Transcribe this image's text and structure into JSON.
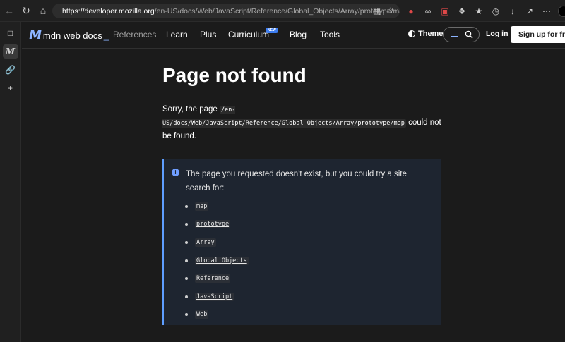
{
  "browser": {
    "url_host": "https://developer.mozilla.org",
    "url_path": "/en-US/docs/Web/JavaScript/Reference/Global_Objects/Array/prototype/map"
  },
  "header": {
    "logo_text": "mdn web docs",
    "logo_suffix": "_",
    "nav": {
      "references": "References",
      "learn": "Learn",
      "plus": "Plus",
      "curriculum": "Curriculum",
      "curriculum_badge": "NEW",
      "blog": "Blog",
      "tools": "Tools"
    },
    "theme_label": "Theme",
    "search_hint": "_",
    "login_label": "Log in",
    "signup_label": "Sign up for free"
  },
  "main": {
    "title": "Page not found",
    "message_prefix": "Sorry, the page",
    "message_path": "/en-US/docs/Web/JavaScript/Reference/Global_Objects/Array/prototype/map",
    "message_suffix": "could not be found.",
    "callout_text": "The page you requested doesn't exist, but you could try a site search for:",
    "suggestions": [
      "map",
      "prototype",
      "Array",
      "Global_Objects",
      "Reference",
      "JavaScript",
      "Web"
    ]
  },
  "colors": {
    "accent": "#8cb4ff",
    "callout_bg": "#1e2530",
    "callout_border": "#5e9eff",
    "page_bg": "#1b1b1b"
  }
}
